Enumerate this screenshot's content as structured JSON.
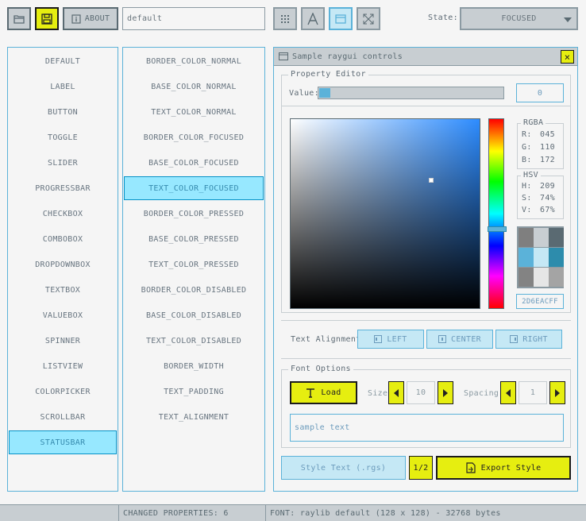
{
  "toolbar": {
    "about_label": "ABOUT",
    "filename_value": "default",
    "state_label": "State:",
    "state_value": "FOCUSED",
    "icons": [
      "folder-open-icon",
      "save-icon",
      "info-icon",
      "grid-icon",
      "font-icon",
      "window-icon",
      "fullscreen-icon",
      "chevron-down-icon"
    ]
  },
  "controls_list": [
    "DEFAULT",
    "LABEL",
    "BUTTON",
    "TOGGLE",
    "SLIDER",
    "PROGRESSBAR",
    "CHECKBOX",
    "COMBOBOX",
    "DROPDOWNBOX",
    "TEXTBOX",
    "VALUEBOX",
    "SPINNER",
    "LISTVIEW",
    "COLORPICKER",
    "SCROLLBAR",
    "STATUSBAR"
  ],
  "controls_selected": "STATUSBAR",
  "properties_list": [
    "BORDER_COLOR_NORMAL",
    "BASE_COLOR_NORMAL",
    "TEXT_COLOR_NORMAL",
    "BORDER_COLOR_FOCUSED",
    "BASE_COLOR_FOCUSED",
    "TEXT_COLOR_FOCUSED",
    "BORDER_COLOR_PRESSED",
    "BASE_COLOR_PRESSED",
    "TEXT_COLOR_PRESSED",
    "BORDER_COLOR_DISABLED",
    "BASE_COLOR_DISABLED",
    "TEXT_COLOR_DISABLED",
    "BORDER_WIDTH",
    "TEXT_PADDING",
    "TEXT_ALIGNMENT"
  ],
  "properties_selected": "TEXT_COLOR_FOCUSED",
  "window": {
    "title": "Sample raygui controls",
    "close_label": "×"
  },
  "property_editor": {
    "title": "Property Editor",
    "value_label": "Value:",
    "value": "0",
    "slider_fraction": 0.0
  },
  "color": {
    "rgba_title": "RGBA",
    "r_label": "R:",
    "r_value": "045",
    "g_label": "G:",
    "g_value": "110",
    "b_label": "B:",
    "b_value": "172",
    "hsv_title": "HSV",
    "h_label": "H:",
    "h_value": "209",
    "s_label": "S:",
    "s_value": "74%",
    "v_label": "V:",
    "v_value": "67%",
    "hex_value": "2D6EACFF",
    "picker_hue_color": "#2d8cff",
    "swatches": [
      "#7f7f7f",
      "#c8ced2",
      "#5a6a72",
      "#5bb2d9",
      "#c5e8f5",
      "#2d8cac",
      "#838383",
      "#e6e6e6",
      "#a4a4a4"
    ]
  },
  "alignment": {
    "label": "Text Alignment:",
    "left": "LEFT",
    "center": "CENTER",
    "right": "RIGHT"
  },
  "font_options": {
    "title": "Font Options",
    "load_label": "Load",
    "size_label": "Size:",
    "size_value": "10",
    "spacing_label": "Spacing:",
    "spacing_value": "1",
    "sample_text": "sample text"
  },
  "bottom_buttons": {
    "style_text": "Style Text (.rgs)",
    "page": "1/2",
    "export": "Export Style"
  },
  "status": {
    "changed": "CHANGED PROPERTIES: 6",
    "font": "FONT: raylib default (128 x 128) - 32768 bytes"
  }
}
